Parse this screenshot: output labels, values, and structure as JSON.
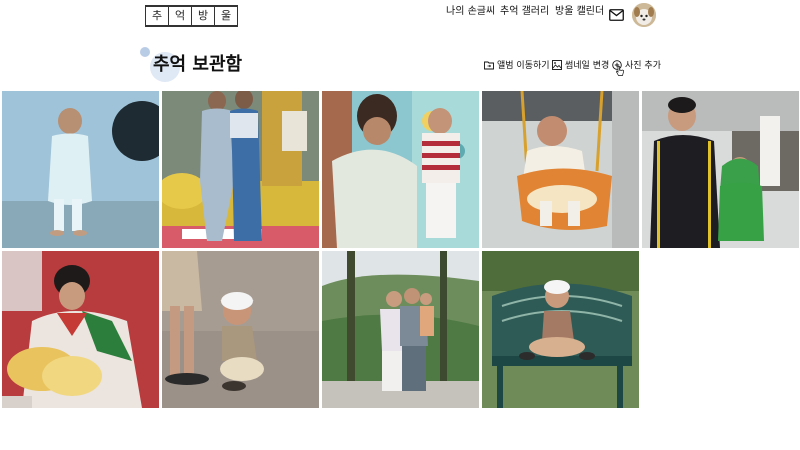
{
  "header": {
    "logo_chars": [
      "추",
      "억",
      "방",
      "울"
    ],
    "nav": [
      {
        "label": "나의 손글씨"
      },
      {
        "label": "추억 갤러리"
      },
      {
        "label": "방울 캘린더"
      }
    ]
  },
  "page": {
    "title": "추억 보관함",
    "actions": [
      {
        "label": "앨범 이동하기",
        "icon": "folder-move-icon"
      },
      {
        "label": "썸네일 변경",
        "icon": "image-edit-icon"
      },
      {
        "label": "사진 추가",
        "icon": "plus-circle-icon"
      }
    ]
  },
  "photos": [
    {
      "alt": "photo-1"
    },
    {
      "alt": "photo-2"
    },
    {
      "alt": "photo-3"
    },
    {
      "alt": "photo-4"
    },
    {
      "alt": "photo-5"
    },
    {
      "alt": "photo-6"
    },
    {
      "alt": "photo-7"
    },
    {
      "alt": "photo-8"
    },
    {
      "alt": "photo-9"
    }
  ],
  "colors": {
    "accent": "#b9cce6"
  }
}
